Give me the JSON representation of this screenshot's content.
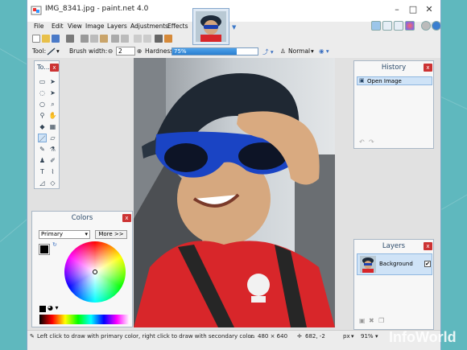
{
  "window": {
    "title": "IMG_8341.jpg - paint.net 4.0"
  },
  "menu": [
    {
      "label": "File"
    },
    {
      "label": "Edit"
    },
    {
      "label": "View"
    },
    {
      "label": "Image"
    },
    {
      "label": "Layers"
    },
    {
      "label": "Adjustments"
    },
    {
      "label": "Effects"
    }
  ],
  "toolbar2": {
    "tool_label": "Tool:",
    "brush_label": "Brush width:",
    "brush_value": "2",
    "hardness_label": "Hardness:",
    "hardness_text": "75%",
    "hardness_value": 0.75,
    "blend_mode": "Normal"
  },
  "tools_panel": {
    "title": "To..."
  },
  "colors_panel": {
    "title": "Colors",
    "palette_select": "Primary",
    "more_button": "More >>"
  },
  "history_panel": {
    "title": "History",
    "items": [
      "Open Image"
    ]
  },
  "layers_panel": {
    "title": "Layers",
    "layer_name": "Background",
    "visible_mark": "✔"
  },
  "status": {
    "hint": "Left click to draw with primary color, right click to draw with secondary color.",
    "image_size": "480 × 640",
    "cursor": "682, -2",
    "unit": "px",
    "zoom": "91%"
  },
  "watermark": "InfoWorld",
  "colors": {
    "accent": "#2a7fd0",
    "close_red": "#cc3333"
  }
}
